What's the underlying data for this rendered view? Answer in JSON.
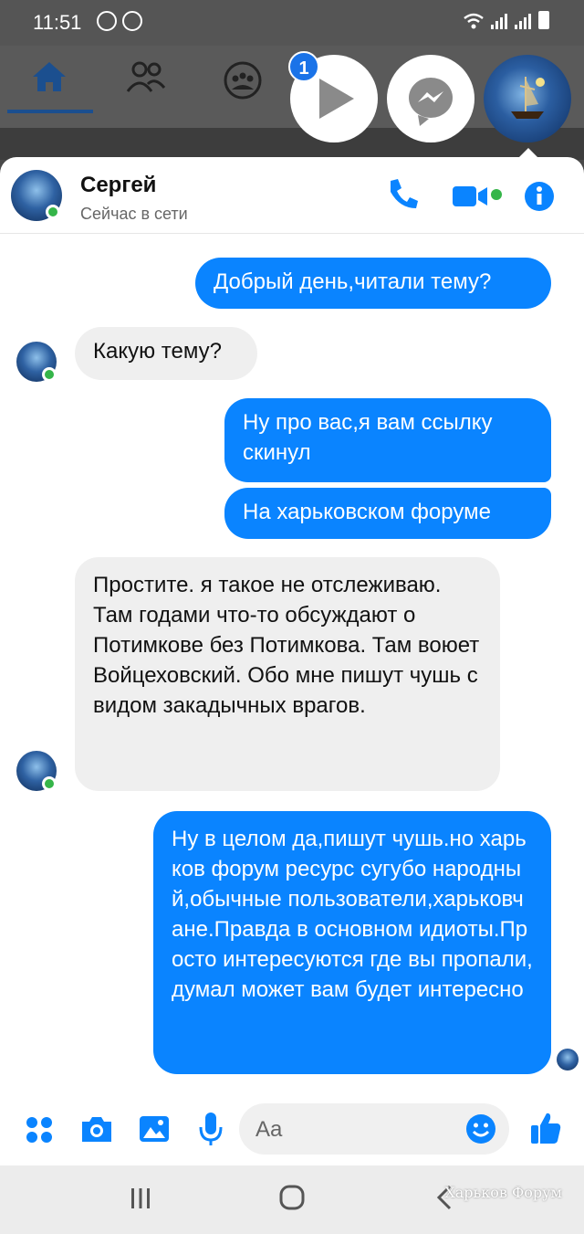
{
  "status_bar": {
    "time": "11:51"
  },
  "chat_heads": {
    "unread_badge": "1"
  },
  "chat": {
    "contact_name": "Сергей",
    "contact_status": "Сейчас в сети",
    "messages": [
      {
        "side": "out",
        "text": "Добрый день,читали тему?"
      },
      {
        "side": "in",
        "text": "Какую тему?"
      },
      {
        "side": "out",
        "text": "Ну про вас,я вам ссылку скинул"
      },
      {
        "side": "out",
        "text": "На харьковском форуме"
      },
      {
        "side": "in",
        "text": "Простите. я такое не отслеживаю. Там годами что-то обсуждают о Потимкове без Потимкова. Там воюет Войцеховский. Обо мне пишут чушь с видом закадычных врагов."
      },
      {
        "side": "out",
        "text": "Ну в целом да,пишут чушь.но харьков форум ресурс сугубо народный,обычные пользователи,харьковчане.Правда в основном идиоты.Просто интересуются где вы пропали,думал может вам будет интересно"
      }
    ]
  },
  "composer": {
    "placeholder": "Aa"
  },
  "watermark": "Харьков Форум",
  "colors": {
    "accent": "#0a84ff",
    "online": "#35b549",
    "incoming_bg": "#efefef"
  },
  "icons": [
    "home-icon",
    "friends-icon",
    "groups-icon",
    "play-icon",
    "messenger-icon",
    "phone-icon",
    "video-icon",
    "info-icon",
    "more-icon",
    "camera-icon",
    "gallery-icon",
    "mic-icon",
    "emoji-icon",
    "like-icon",
    "recents-icon",
    "home-nav-icon",
    "back-icon"
  ]
}
